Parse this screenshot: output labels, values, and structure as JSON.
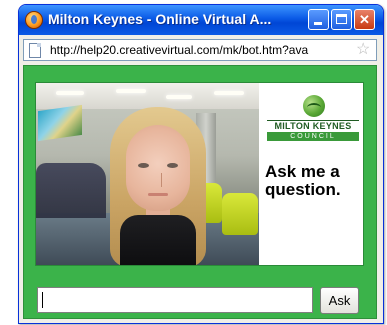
{
  "window": {
    "title": "Milton Keynes - Online Virtual A...",
    "controls": {
      "minimize_icon": "minimize-icon",
      "maximize_icon": "maximize-icon",
      "close_icon": "close-icon"
    }
  },
  "address_bar": {
    "url": "http://help20.creativevirtual.com/mk/bot.htm?ava",
    "page_icon": "page-icon",
    "favorite_icon": "star-icon"
  },
  "main": {
    "avatar_photo": "virtual-assistant-photo",
    "logo": {
      "name": "MILTON KEYNES",
      "subtitle": "COUNCIL"
    },
    "prompt": "Ask me a question."
  },
  "question_form": {
    "input_value": "",
    "submit_label": "Ask"
  },
  "colors": {
    "titlebar": "#0a5ae6",
    "content_background": "#3bb34a",
    "logo_green": "#1f5b22"
  }
}
